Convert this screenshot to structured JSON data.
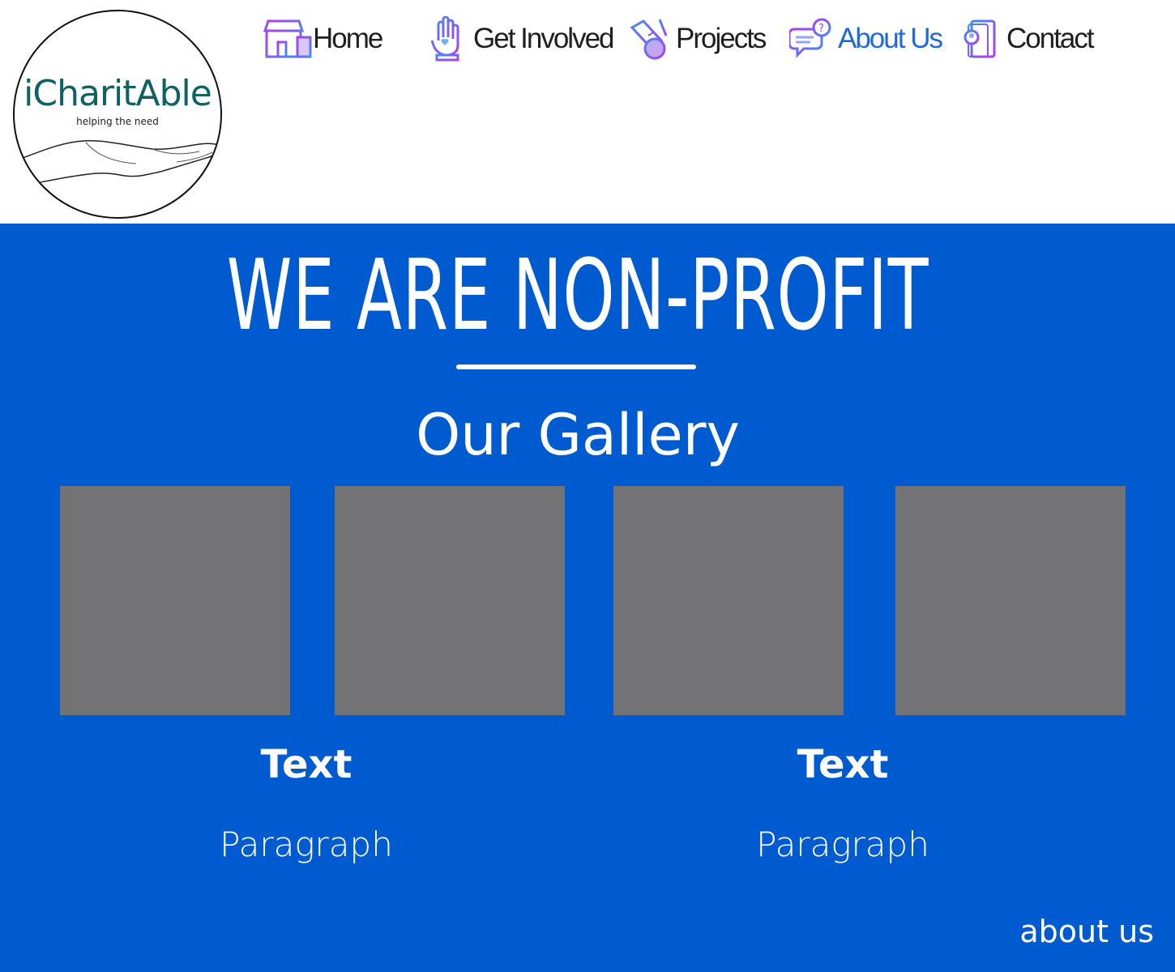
{
  "logo": {
    "name": "iCharitAble",
    "tagline": "helping the need",
    "icon": "open-hand-icon"
  },
  "nav": {
    "items": [
      {
        "label": "Home",
        "icon": "storefront-icon",
        "active": false
      },
      {
        "label": "Get Involved",
        "icon": "raised-hand-heart-icon",
        "active": false
      },
      {
        "label": "Projects",
        "icon": "broom-pointer-icon",
        "active": false
      },
      {
        "label": "About Us",
        "icon": "chat-question-icon",
        "active": true
      },
      {
        "label": "Contact",
        "icon": "contact-book-icon",
        "active": false
      }
    ],
    "colors": {
      "text": "#1f1f1f",
      "active": "#1f6ad8",
      "icon_gradient": [
        "#b13bf0",
        "#3f8cf5"
      ]
    }
  },
  "hero": {
    "title": "WE ARE NON-PROFIT",
    "background": "#005ad0"
  },
  "gallery": {
    "title": "Our Gallery",
    "image_color": "#737375",
    "image_count": 4
  },
  "columns": [
    {
      "heading": "Text",
      "paragraph": "Paragraph"
    },
    {
      "heading": "Text",
      "paragraph": "Paragraph"
    }
  ],
  "footer": {
    "link": "about us"
  }
}
